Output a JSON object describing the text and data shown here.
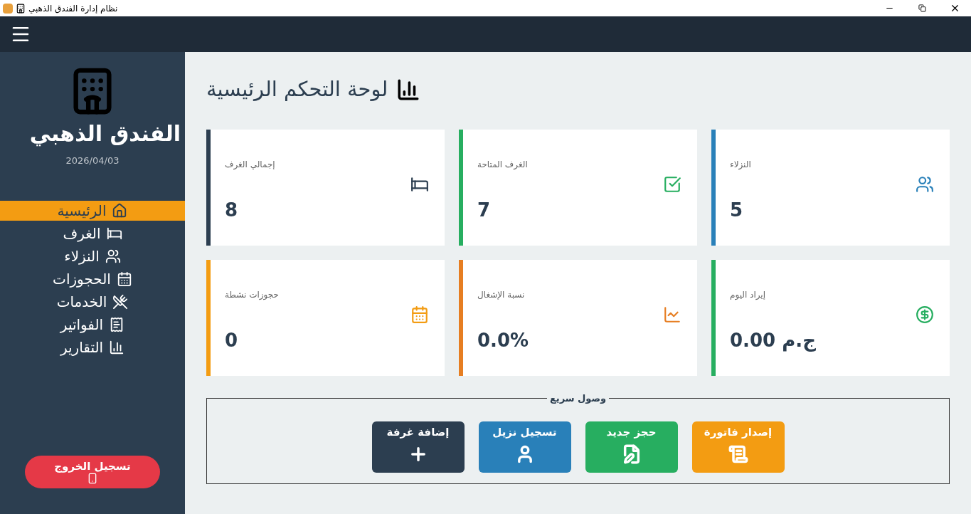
{
  "window": {
    "title": "نظام إدارة الفندق الذهبي"
  },
  "sidebar": {
    "hotel_name": "الفندق الذهبي",
    "date": "2026/04/03",
    "items": [
      {
        "label": "الرئيسية",
        "selected": true
      },
      {
        "label": "الغرف",
        "selected": false
      },
      {
        "label": "النزلاء",
        "selected": false
      },
      {
        "label": "الحجوزات",
        "selected": false
      },
      {
        "label": "الخدمات",
        "selected": false
      },
      {
        "label": "الفواتير",
        "selected": false
      },
      {
        "label": "التقارير",
        "selected": false
      }
    ],
    "logout": "تسجيل الخروج"
  },
  "page_title": "لوحة التحكم الرئيسية",
  "stats": [
    {
      "label": "النزلاء",
      "value": "5",
      "color": "#2980b9"
    },
    {
      "label": "الغرف المتاحة",
      "value": "7",
      "color": "#27ae60"
    },
    {
      "label": "إجمالي الغرف",
      "value": "8",
      "color": "#2c3e50"
    },
    {
      "label": "إيراد اليوم",
      "value": "0.00 ج.م",
      "color": "#27ae60"
    },
    {
      "label": "نسبة الإشغال",
      "value": "0.0%",
      "color": "#e67e22"
    },
    {
      "label": "حجوزات نشطة",
      "value": "0",
      "color": "#f39c12"
    }
  ],
  "quick_access": {
    "title": "وصول سريع",
    "buttons": [
      {
        "label": "إصدار فاتورة",
        "color": "#f39c12"
      },
      {
        "label": "حجز جديد",
        "color": "#27ae60"
      },
      {
        "label": "تسجيل نزيل",
        "color": "#2980b9"
      },
      {
        "label": "إضافة غرفة",
        "color": "#2c3e50"
      }
    ]
  }
}
